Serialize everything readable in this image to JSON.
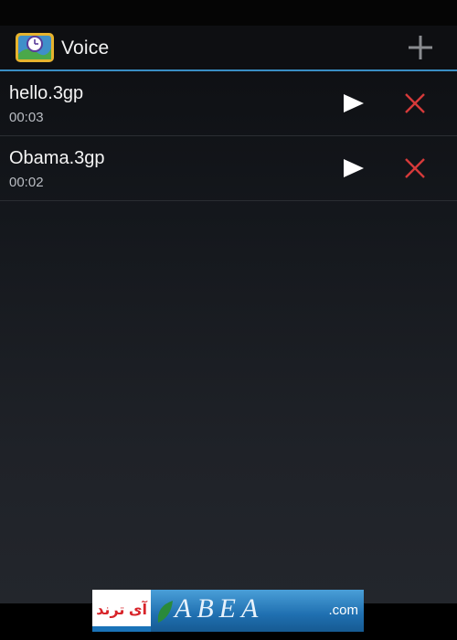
{
  "app": {
    "title": "Voice"
  },
  "recordings": [
    {
      "name": "hello.3gp",
      "duration": "00:03"
    },
    {
      "name": "Obama.3gp",
      "duration": "00:02"
    }
  ],
  "banner": {
    "text": "آی ترند",
    "domain": ".com"
  },
  "colors": {
    "accent": "#3a8ec4",
    "delete": "#d63a3a",
    "play": "#ffffff"
  }
}
